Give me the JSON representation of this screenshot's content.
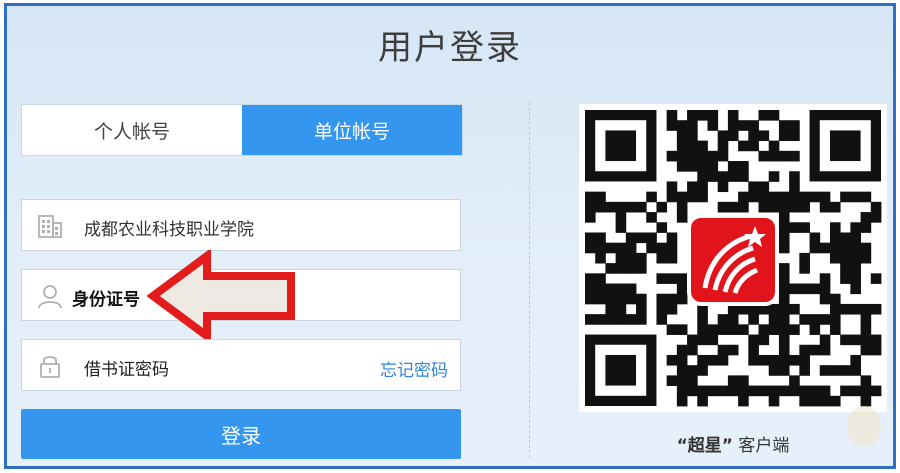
{
  "page_title": "用户登录",
  "tabs": [
    {
      "label": "个人帐号",
      "active": false
    },
    {
      "label": "单位帐号",
      "active": true
    }
  ],
  "fields": {
    "school": {
      "value": "成都农业科技职业学院",
      "icon": "building-icon"
    },
    "id": {
      "value": "身份证号",
      "icon": "user-icon"
    },
    "password": {
      "value": "借书证密码",
      "icon": "lock-icon",
      "forgot_label": "忘记密码"
    }
  },
  "login_button": {
    "label": "登录"
  },
  "qr": {
    "client_label_quoted": "“超星”",
    "client_label_suffix": "客户端"
  },
  "colors": {
    "accent": "#3596f0",
    "frame": "#2e6fc4",
    "arrow": "#e21b1b",
    "link": "#2f86d8"
  }
}
